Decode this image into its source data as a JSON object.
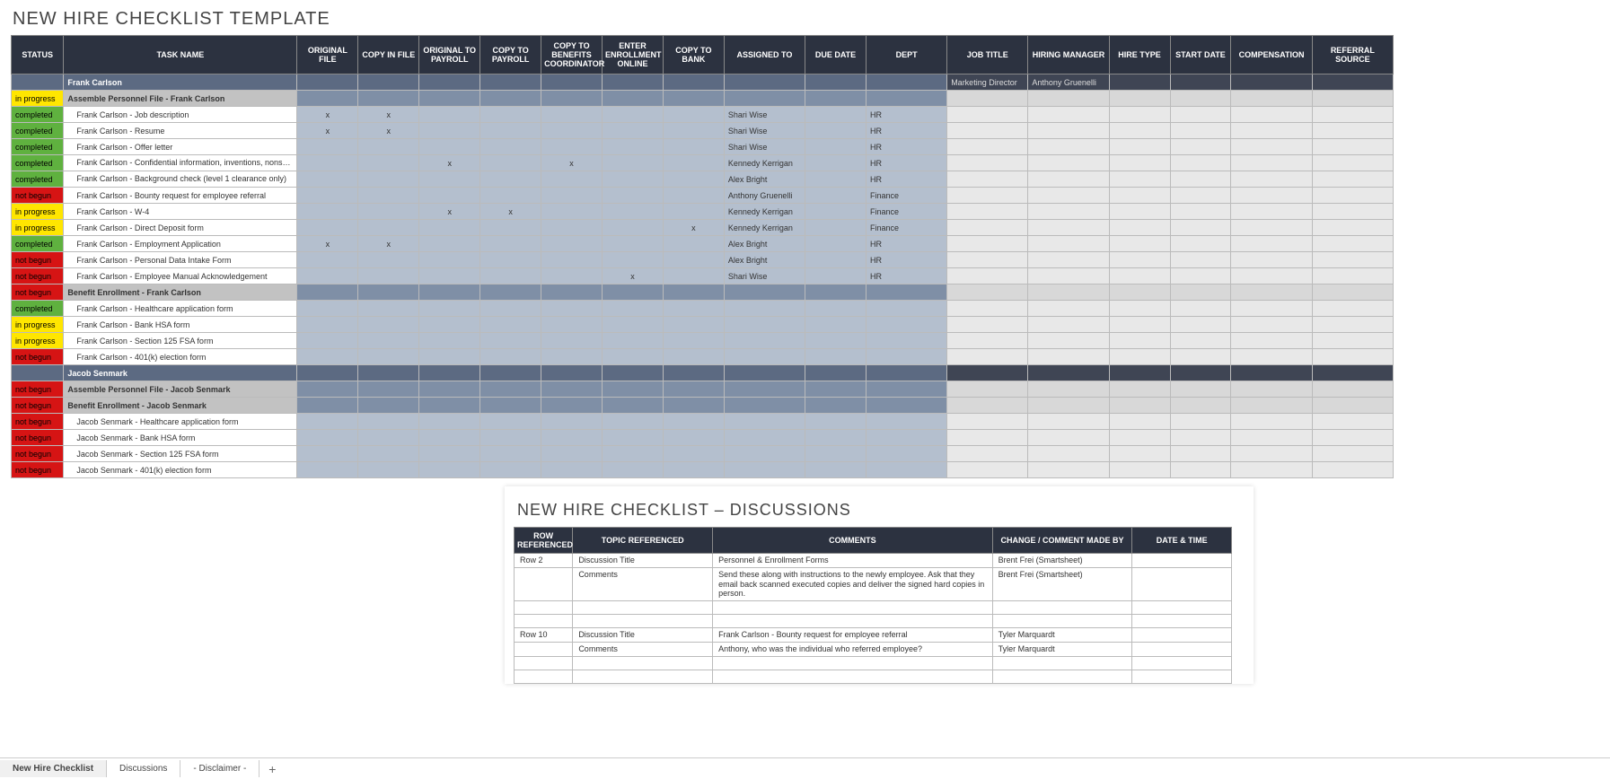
{
  "title": "NEW HIRE CHECKLIST TEMPLATE",
  "columns": [
    "STATUS",
    "TASK NAME",
    "ORIGINAL FILE",
    "COPY IN FILE",
    "ORIGINAL TO PAYROLL",
    "COPY TO PAYROLL",
    "COPY TO BENEFITS COORDINATOR",
    "ENTER ENROLLMENT ONLINE",
    "COPY TO BANK",
    "ASSIGNED TO",
    "DUE DATE",
    "DEPT",
    "JOB TITLE",
    "HIRING MANAGER",
    "HIRE TYPE",
    "START DATE",
    "COMPENSATION",
    "REFERRAL SOURCE"
  ],
  "rows": [
    {
      "type": "emp",
      "task": "Frank Carlson",
      "jobTitle": "Marketing Director",
      "hiringMgr": "Anthony Gruenelli"
    },
    {
      "type": "sub",
      "status": "in progress",
      "task": "Assemble Personnel File - Frank Carlson"
    },
    {
      "type": "task",
      "status": "completed",
      "task": "Frank Carlson - Job description",
      "marks": {
        "ORIGINAL FILE": "x",
        "COPY IN FILE": "x"
      },
      "assigned": "Shari Wise",
      "dept": "HR"
    },
    {
      "type": "task",
      "status": "completed",
      "task": "Frank Carlson - Resume",
      "marks": {
        "ORIGINAL FILE": "x",
        "COPY IN FILE": "x"
      },
      "assigned": "Shari Wise",
      "dept": "HR"
    },
    {
      "type": "task",
      "status": "completed",
      "task": "Frank Carlson - Offer letter",
      "assigned": "Shari Wise",
      "dept": "HR"
    },
    {
      "type": "task",
      "status": "completed",
      "multiline": true,
      "task": "Frank Carlson - Confidential information, inventions, nonsolicitation & noncompete agreement",
      "marks": {
        "ORIGINAL TO PAYROLL": "x",
        "COPY TO BENEFITS COORDINATOR": "x"
      },
      "assigned": "Kennedy Kerrigan",
      "dept": "HR"
    },
    {
      "type": "task",
      "status": "completed",
      "multiline": true,
      "task": "Frank Carlson - Background check (level 1 clearance only)",
      "assigned": "Alex Bright",
      "dept": "HR"
    },
    {
      "type": "task",
      "status": "not begun",
      "task": "Frank Carlson - Bounty request for employee referral",
      "assigned": "Anthony Gruenelli",
      "dept": "Finance"
    },
    {
      "type": "task",
      "status": "in progress",
      "task": "Frank Carlson - W-4",
      "marks": {
        "ORIGINAL TO PAYROLL": "x",
        "COPY TO PAYROLL": "x"
      },
      "assigned": "Kennedy Kerrigan",
      "dept": "Finance"
    },
    {
      "type": "task",
      "status": "in progress",
      "task": "Frank Carlson - Direct Deposit form",
      "marks": {
        "COPY TO BANK": "x"
      },
      "assigned": "Kennedy Kerrigan",
      "dept": "Finance"
    },
    {
      "type": "task",
      "status": "completed",
      "task": "Frank Carlson - Employment Application",
      "marks": {
        "ORIGINAL FILE": "x",
        "COPY IN FILE": "x"
      },
      "assigned": "Alex Bright",
      "dept": "HR"
    },
    {
      "type": "task",
      "status": "not begun",
      "task": "Frank Carlson - Personal Data Intake Form",
      "assigned": "Alex Bright",
      "dept": "HR"
    },
    {
      "type": "task",
      "status": "not begun",
      "task": "Frank Carlson - Employee Manual Acknowledgement",
      "marks": {
        "ENTER ENROLLMENT ONLINE": "x"
      },
      "assigned": "Shari Wise",
      "dept": "HR"
    },
    {
      "type": "sub",
      "status": "not begun",
      "task": "Benefit Enrollment - Frank Carlson"
    },
    {
      "type": "task",
      "status": "completed",
      "task": "Frank Carlson - Healthcare application form"
    },
    {
      "type": "task",
      "status": "in progress",
      "task": "Frank Carlson - Bank HSA form"
    },
    {
      "type": "task",
      "status": "in progress",
      "task": "Frank Carlson - Section 125 FSA form"
    },
    {
      "type": "task",
      "status": "not begun",
      "task": "Frank Carlson - 401(k) election form"
    },
    {
      "type": "emp",
      "task": "Jacob Senmark"
    },
    {
      "type": "sub",
      "status": "not begun",
      "task": "Assemble Personnel File - Jacob Senmark"
    },
    {
      "type": "sub",
      "status": "not begun",
      "task": "Benefit Enrollment - Jacob Senmark"
    },
    {
      "type": "task",
      "status": "not begun",
      "task": "Jacob Senmark - Healthcare application form"
    },
    {
      "type": "task",
      "status": "not begun",
      "task": "Jacob Senmark - Bank HSA form"
    },
    {
      "type": "task",
      "status": "not begun",
      "task": "Jacob Senmark - Section 125 FSA form"
    },
    {
      "type": "task",
      "status": "not begun",
      "task": "Jacob Senmark - 401(k) election form"
    }
  ],
  "disc": {
    "title": "NEW HIRE CHECKLIST  –  DISCUSSIONS",
    "columns": [
      "ROW REFERENCED",
      "TOPIC REFERENCED",
      "COMMENTS",
      "CHANGE / COMMENT MADE BY",
      "DATE & TIME"
    ],
    "rows": [
      {
        "row": "Row 2",
        "topic": "Discussion Title",
        "comment": "Personnel & Enrollment Forms",
        "by": "Brent Frei (Smartsheet)",
        "dt": ""
      },
      {
        "row": "",
        "topic": "Comments",
        "comment": "Send these along with instructions to the newly employee.  Ask that they email back scanned executed copies and deliver the signed hard copies in person.",
        "by": "Brent Frei (Smartsheet)",
        "dt": ""
      },
      {
        "row": "",
        "topic": "",
        "comment": "",
        "by": "",
        "dt": ""
      },
      {
        "row": "",
        "topic": "",
        "comment": "",
        "by": "",
        "dt": ""
      },
      {
        "row": "Row 10",
        "topic": "Discussion Title",
        "comment": "Frank Carlson - Bounty request for employee referral",
        "by": "Tyler Marquardt",
        "dt": ""
      },
      {
        "row": "",
        "topic": "Comments",
        "comment": "Anthony, who was the individual who referred employee?",
        "by": "Tyler Marquardt",
        "dt": ""
      },
      {
        "row": "",
        "topic": "",
        "comment": "",
        "by": "",
        "dt": ""
      },
      {
        "row": "",
        "topic": "",
        "comment": "",
        "by": "",
        "dt": ""
      }
    ]
  },
  "tabs": [
    "New Hire Checklist",
    "Discussions",
    "- Disclaimer -"
  ],
  "addTab": "+"
}
